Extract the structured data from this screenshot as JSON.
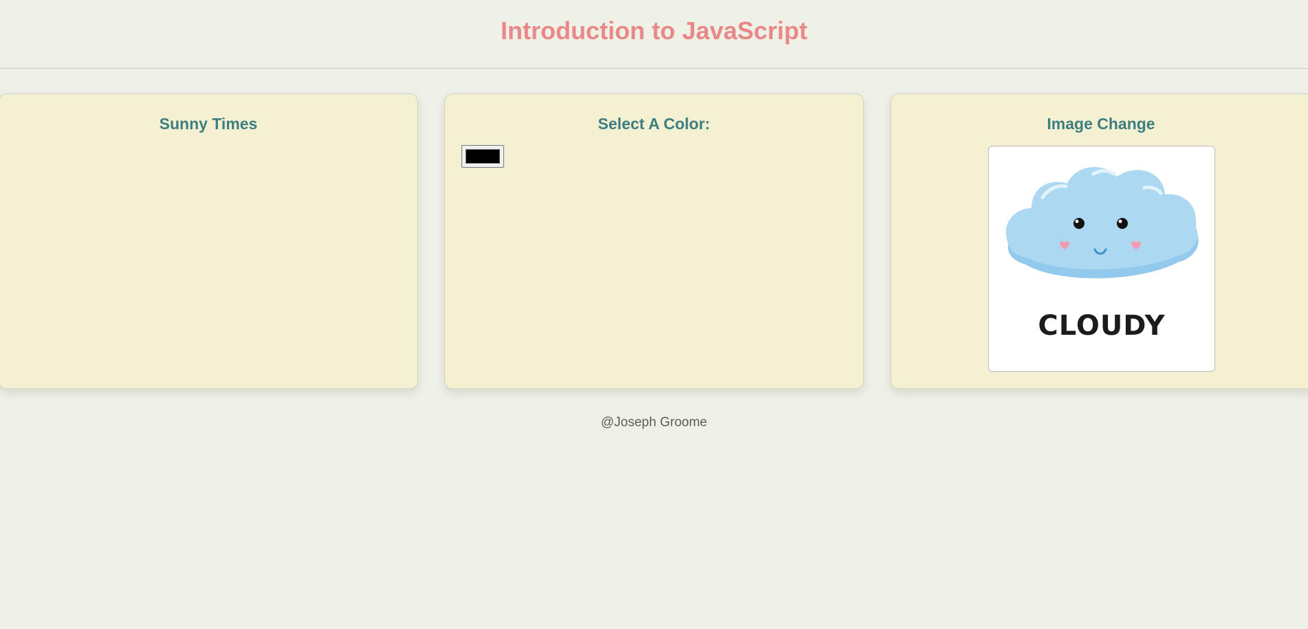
{
  "header": {
    "title": "Introduction to JavaScript"
  },
  "cards": {
    "sunny": {
      "title": "Sunny Times"
    },
    "color": {
      "title": "Select A Color:",
      "input_value": "#000000"
    },
    "image": {
      "title": "Image Change",
      "caption": "CLOUDY",
      "icon": "cloud-icon"
    }
  },
  "footer": {
    "text": "@Joseph Groome"
  },
  "colors": {
    "background": "#eff1e7",
    "card": "#f4f1d3",
    "title": "#e88888",
    "card_title": "#3e7d80",
    "cloud": "#acd8f2"
  }
}
